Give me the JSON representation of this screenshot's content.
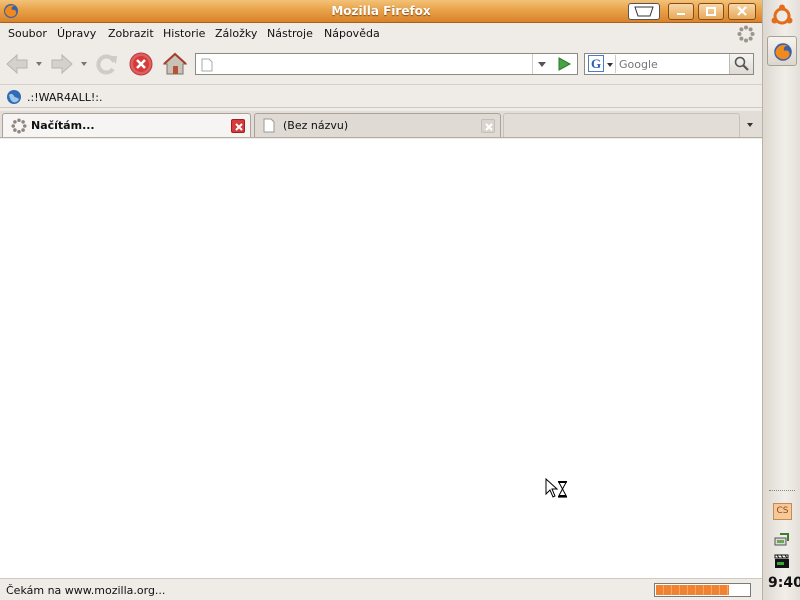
{
  "window": {
    "title": "Mozilla Firefox"
  },
  "menu": {
    "items": [
      "Soubor",
      "Úpravy",
      "Zobrazit",
      "Historie",
      "Záložky",
      "Nástroje",
      "Nápověda"
    ]
  },
  "navigation": {
    "url_value": "",
    "search_placeholder": "Google",
    "search_engine_icon": "G"
  },
  "bookmarks": {
    "items": [
      {
        "label": ".:!WAR4ALL!:."
      }
    ]
  },
  "tabs": [
    {
      "label": "Načítám...",
      "state": "loading",
      "active": true
    },
    {
      "label": "(Bez názvu)",
      "state": "idle",
      "active": false
    }
  ],
  "status": {
    "text": "Čekám na www.mozilla.org...",
    "progress": 0.78
  },
  "panel": {
    "tray_label": "CS",
    "clock": "9:40"
  },
  "colors": {
    "titlebar": "#e9a248",
    "progress": "#f08232",
    "stop": "#d63a3a"
  },
  "icons": [
    "firefox-icon",
    "back-icon",
    "forward-icon",
    "reload-icon",
    "stop-icon",
    "home-icon",
    "go-icon",
    "search-icon",
    "globe-icon",
    "throbber-icon",
    "page-icon",
    "close-icon",
    "hourglass-cursor-icon",
    "ubuntu-icon",
    "network-icon",
    "clapper-icon"
  ]
}
